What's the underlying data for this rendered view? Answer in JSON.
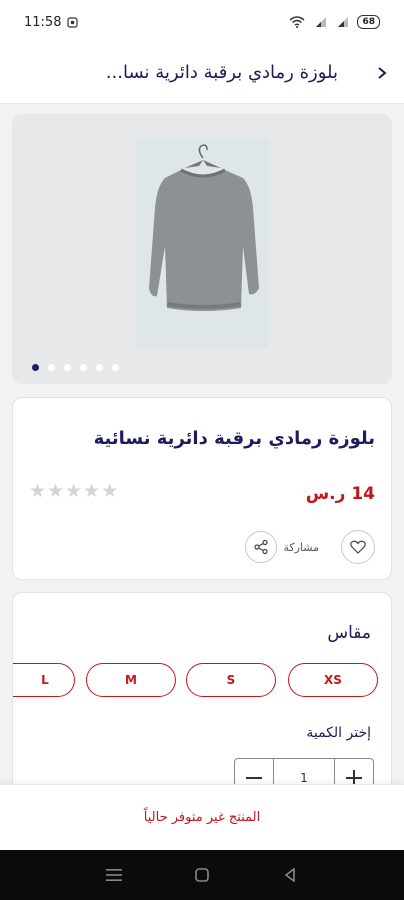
{
  "status": {
    "time": "11:58",
    "battery": "68"
  },
  "header": {
    "title": "بلوزة رمادي برقبة دائرية نسا..."
  },
  "gallery": {
    "dot_count": 6,
    "active_index": 0
  },
  "product": {
    "name": "بلوزة رمادي برقبة دائرية نسائية",
    "price": "14 ر.س",
    "rating": 0,
    "rating_max": 5,
    "share_label": "مشاركة"
  },
  "options": {
    "size_label": "مقاس",
    "sizes": [
      "XS",
      "S",
      "M",
      "L"
    ],
    "quantity_label": "إختر الكمية",
    "quantity": "1"
  },
  "availability": {
    "message": "المنتج غير متوفر حالياً"
  },
  "colors": {
    "navy": "#1d1d5b",
    "red": "#c4161c",
    "image_bg": "#e6e8e9"
  }
}
